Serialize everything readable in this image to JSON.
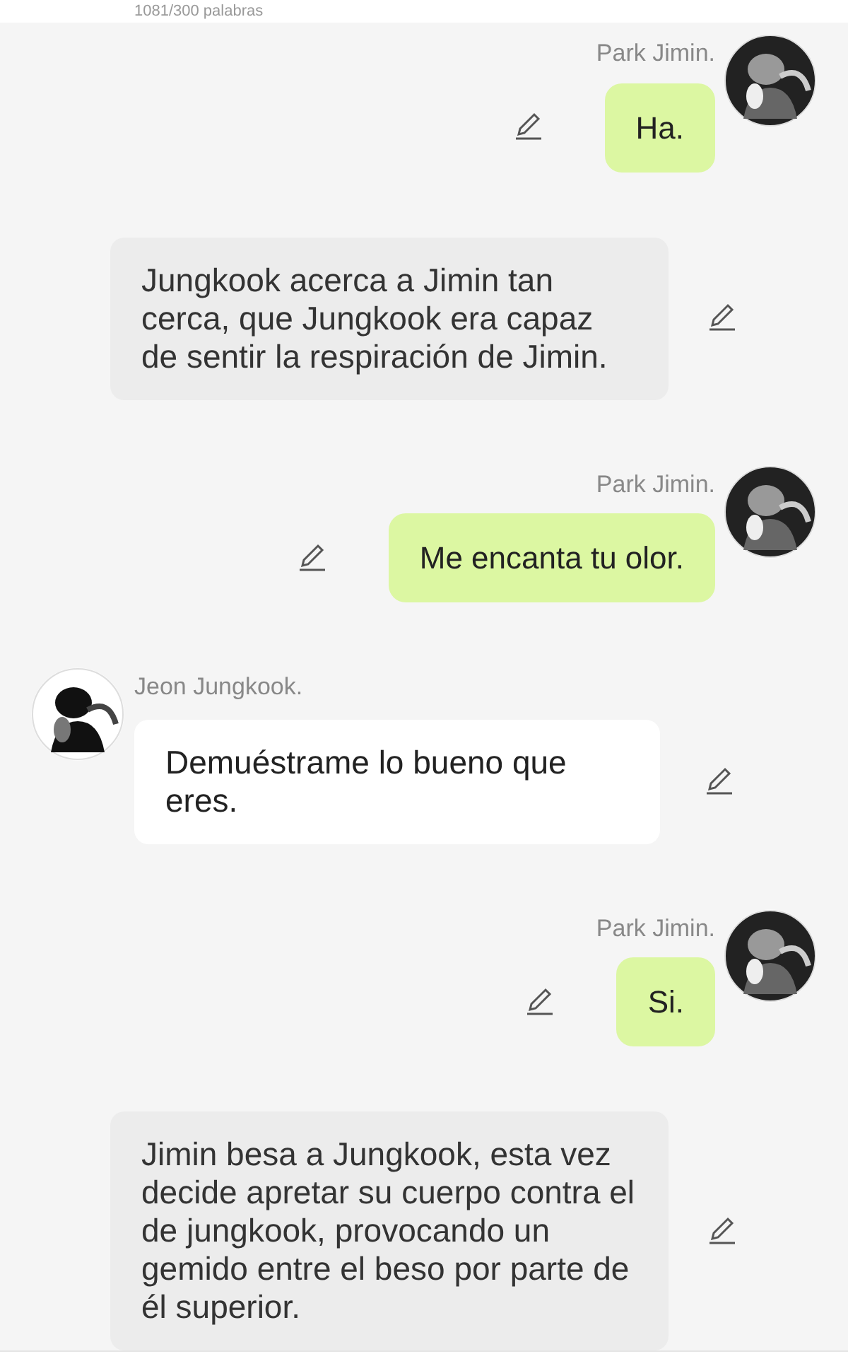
{
  "header": {
    "word_count": "1081/300 palabras"
  },
  "messages": [
    {
      "kind": "user",
      "name": "Park Jimin.",
      "text": "Ha."
    },
    {
      "kind": "narration",
      "text": "Jungkook acerca a Jimin tan cerca, que Jungkook era capaz de sentir la respiración de Jimin."
    },
    {
      "kind": "user",
      "name": "Park Jimin.",
      "text": "Me encanta tu olor."
    },
    {
      "kind": "character",
      "name": "Jeon Jungkook.",
      "text": "Demuéstrame lo bueno que eres."
    },
    {
      "kind": "user",
      "name": "Park Jimin.",
      "text": "Si."
    },
    {
      "kind": "narration",
      "text": "Jimin besa a Jungkook, esta vez decide apretar su cuerpo contra el de jungkook, provocando un gemido entre el beso por parte de él superior."
    }
  ]
}
